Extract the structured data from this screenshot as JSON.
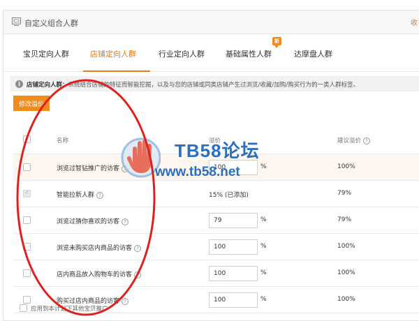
{
  "panel": {
    "title": "自定义组合人群",
    "title_right": "收"
  },
  "tabs": [
    {
      "label": "宝贝定向人群",
      "active": false
    },
    {
      "label": "店铺定向人群",
      "active": true
    },
    {
      "label": "行业定向人群",
      "active": false
    },
    {
      "label": "基础属性人群",
      "active": false,
      "badge": "新"
    },
    {
      "label": "达摩盘人群",
      "active": false
    }
  ],
  "info": {
    "bold": "店铺定向人群：",
    "text": "系统结合店铺的特征而智能挖掘，以及与您的店铺或同类店铺产生过浏览/收藏/加购/购买行为的一类人群标签。"
  },
  "edit_button": "修改溢价",
  "table": {
    "headers": {
      "name": "名称",
      "premium": "溢价",
      "suggest": "建议溢价"
    },
    "rows": [
      {
        "name": "浏览过智钻推广的访客",
        "premium": "100",
        "suggest": "100%",
        "checked": false,
        "disabled": false,
        "static": false
      },
      {
        "name": "智能拉新人群",
        "premium": "15% (已添加)",
        "suggest": "79%",
        "checked": true,
        "disabled": true,
        "static": true
      },
      {
        "name": "浏览过猜你喜欢的访客",
        "premium": "79",
        "suggest": "79%",
        "checked": false,
        "disabled": false,
        "static": false
      },
      {
        "name": "浏览未购买店内商品的访客",
        "premium": "100",
        "suggest": "100%",
        "checked": false,
        "disabled": false,
        "static": false
      },
      {
        "name": "店内商品放入购物车的访客",
        "premium": "100",
        "suggest": "100%",
        "checked": false,
        "disabled": false,
        "static": false
      },
      {
        "name": "购买过店内商品的访客",
        "premium": "100",
        "suggest": "100%",
        "checked": false,
        "disabled": false,
        "static": false
      }
    ],
    "pct_symbol": "%",
    "help_symbol": "?"
  },
  "footer": {
    "label": "应用到本计划下其他宝贝推广"
  },
  "watermark": {
    "title": "TB58论坛",
    "url": "www.tb58.net"
  },
  "colors": {
    "accent": "#e87a1a",
    "button": "#f08c1e",
    "watermark": "#2b6fbf",
    "annotation": "#e0201a"
  }
}
